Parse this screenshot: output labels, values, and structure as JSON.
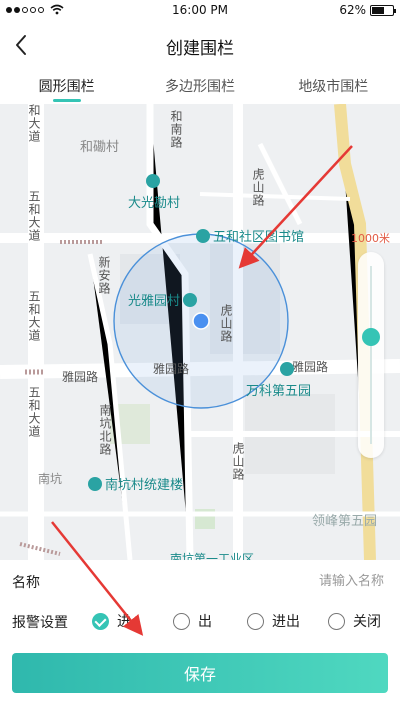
{
  "status_bar": {
    "time": "16:00 PM",
    "battery": "62%",
    "battery_level": 0.62
  },
  "nav": {
    "title": "创建围栏",
    "back_icon": "chevron-left-icon"
  },
  "tabs": [
    {
      "label": "圆形围栏",
      "active": true
    },
    {
      "label": "多边形围栏",
      "active": false
    },
    {
      "label": "地级市围栏",
      "active": false
    }
  ],
  "map": {
    "radius_label": "1000米",
    "zoom_level": 0.38,
    "labels": {
      "road_heda_top": "和大道",
      "road_wuhe_left": "五和大道",
      "road_wuhe_left2": "五和大道",
      "road_wuhe_bottom": "五和大道",
      "area_heli": "和磡村",
      "road_henan": "和南路",
      "road_hushan_top": "虎山路",
      "road_hushan_mid": "虎山路",
      "road_hushan_bottom": "虎山路",
      "road_xinan": "新安路",
      "road_yayuan_left": "雅园路",
      "road_yayuan_mid": "雅园路",
      "road_yayuan_right": "雅园路",
      "road_nankeng_north": "南坑北路",
      "area_nankeng": "南坑",
      "area_lingfeng": "领峰第五园",
      "area_nankeng_bottom": "南坑第一工业区"
    },
    "pois": {
      "daguang": "大光勘村",
      "library": "五和社区图书馆",
      "guangya": "光雅园村",
      "vanke": "万科第五园",
      "nankeng_building": "南坑村统建楼"
    }
  },
  "form": {
    "name_label": "名称",
    "name_placeholder": "请输入名称",
    "name_value": "",
    "alarm_label": "报警设置",
    "alarm_options": [
      {
        "label": "进",
        "checked": true
      },
      {
        "label": "出",
        "checked": false
      },
      {
        "label": "进出",
        "checked": false
      },
      {
        "label": "关闭",
        "checked": false
      }
    ],
    "save_label": "保存"
  },
  "colors": {
    "accent": "#35c4b5",
    "annotation_arrow": "#e53935",
    "fence_circle": "#4a90d9"
  }
}
